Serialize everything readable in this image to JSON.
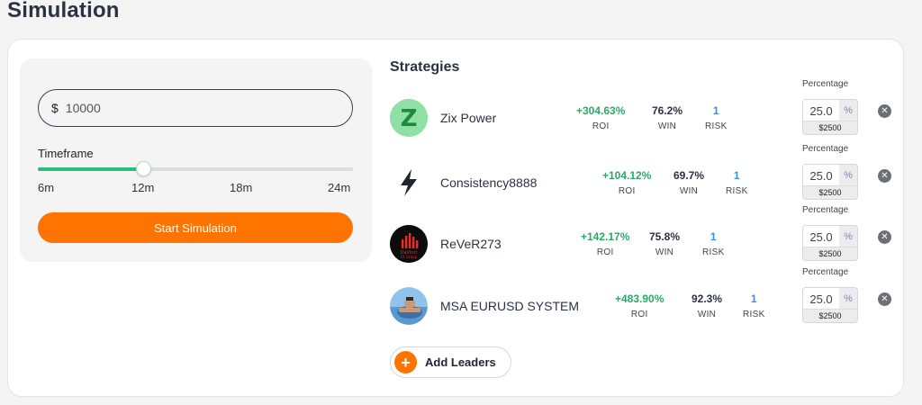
{
  "page": {
    "title": "Simulation"
  },
  "simulator": {
    "currency": "$",
    "amount": "10000",
    "timeframe_label": "Timeframe",
    "timeframe_ticks": [
      "6m",
      "12m",
      "18m",
      "24m"
    ],
    "timeframe_selected_index": 1,
    "start_label": "Start Simulation",
    "accent_color": "#ff7300",
    "slider_color": "#2ebc7a"
  },
  "strategies": {
    "title": "Strategies",
    "percentage_label": "Percentage",
    "roi_label": "ROI",
    "win_label": "WIN",
    "risk_label": "RISK",
    "items": [
      {
        "name": "Zix Power",
        "roi": "+304.63%",
        "win": "76.2%",
        "risk": "1",
        "percentage": "25.0",
        "percent_sign": "%",
        "allocation": "$2500",
        "avatar_icon": "zix-logo-icon",
        "avatar_text": "Z"
      },
      {
        "name": "Consistency8888",
        "roi": "+104.12%",
        "win": "69.7%",
        "risk": "1",
        "percentage": "25.0",
        "percent_sign": "%",
        "allocation": "$2500",
        "avatar_icon": "lightning-icon",
        "avatar_text": ""
      },
      {
        "name": "ReVeR273",
        "roi": "+142.17%",
        "win": "75.8%",
        "risk": "1",
        "percentage": "25.0",
        "percent_sign": "%",
        "allocation": "$2500",
        "avatar_icon": "davinci-fx-logo-icon",
        "avatar_text": "DaVinci FX Group"
      },
      {
        "name": "MSA EURUSD SYSTEM",
        "roi": "+483.90%",
        "win": "92.3%",
        "risk": "1",
        "percentage": "25.0",
        "percent_sign": "%",
        "allocation": "$2500",
        "avatar_icon": "user-photo-avatar",
        "avatar_text": ""
      }
    ],
    "remove_symbol": "✕",
    "add_label": "Add Leaders",
    "add_symbol": "+"
  }
}
